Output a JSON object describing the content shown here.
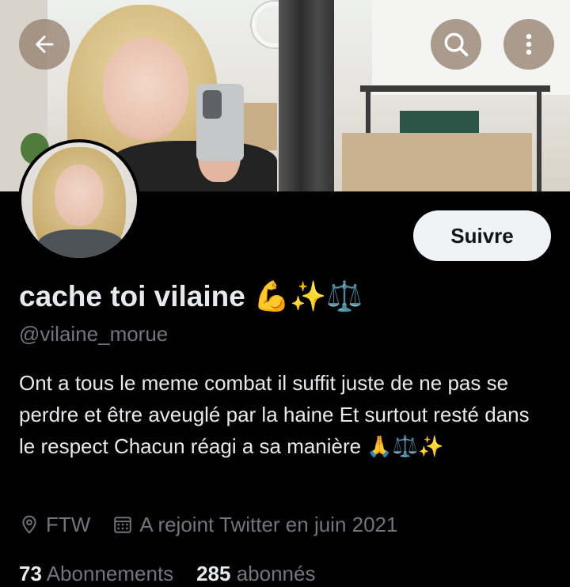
{
  "profile": {
    "display_name": "cache toi vilaine 💪✨⚖️",
    "handle": "@vilaine_morue",
    "bio": "Ont a tous le meme combat il suffit juste de ne pas se perdre et être aveuglé par la haine Et surtout resté dans le respect Chacun réagi a sa manière 🙏⚖️✨",
    "location": "FTW",
    "joined": "A rejoint Twitter en juin 2021"
  },
  "actions": {
    "follow_label": "Suivre"
  },
  "stats": {
    "following_count": "73",
    "following_label": "Abonnements",
    "followers_count": "285",
    "followers_label": "abonnés"
  },
  "icons": {
    "back": "arrow-left-icon",
    "search": "search-icon",
    "more": "more-vertical-icon",
    "location": "location-pin-icon",
    "calendar": "calendar-icon"
  },
  "colors": {
    "background": "#000000",
    "primary_text": "#e7e9ea",
    "secondary_text": "#71767b",
    "follow_button_bg": "#eff3f4",
    "overlay_button_bg": "#968270"
  }
}
